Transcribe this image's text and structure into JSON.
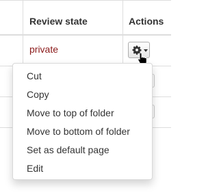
{
  "table": {
    "headers": {
      "review_state": "Review state",
      "actions": "Actions"
    },
    "rows": [
      {
        "review_state": "private"
      }
    ]
  },
  "actions_button": {
    "icon": "gear-icon",
    "caret_icon": "caret-down-icon"
  },
  "dropdown_menu": {
    "items": [
      {
        "label": "Cut"
      },
      {
        "label": "Copy"
      },
      {
        "label": "Move to top of folder"
      },
      {
        "label": "Move to bottom of folder"
      },
      {
        "label": "Set as default page"
      },
      {
        "label": "Edit"
      }
    ]
  },
  "colors": {
    "state_private": "#8b1a1a",
    "border": "#dddddd"
  }
}
